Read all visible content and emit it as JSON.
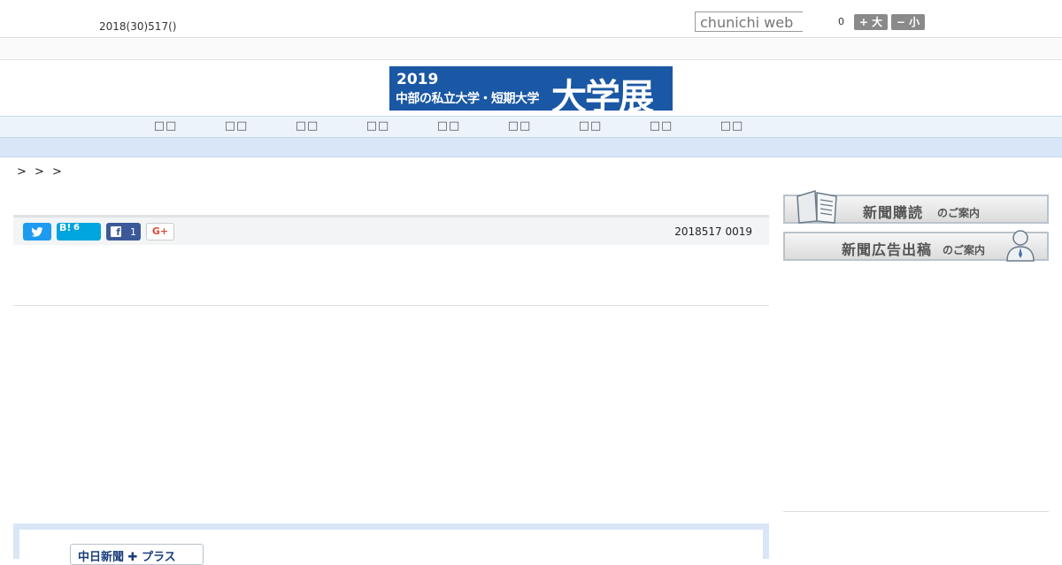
{
  "header": {
    "date": "2018(30)517()",
    "search_placeholder": "chunichi web",
    "count": "0",
    "font_plus": "+ 大",
    "font_minus": "− 小"
  },
  "banner": {
    "year": "2019",
    "subtitle": "中部の私立大学・短期大学",
    "big": "大学展"
  },
  "nav": {
    "items": [
      "□□",
      "□□",
      "□□",
      "□□",
      "□□",
      "□□",
      "□□",
      "□□",
      "□□"
    ]
  },
  "breadcrumb": "> > >",
  "share": {
    "hatena_label": "B!",
    "hatena_count": "6",
    "facebook_count": "1",
    "gplus_label": "G+",
    "posted": "2018517 0019"
  },
  "sidebar": {
    "subscribe_big": "新聞購読",
    "subscribe_small": "のご案内",
    "ad_big": "新聞広告出稿",
    "ad_small": "のご案内"
  },
  "promo": {
    "logo_text": "中日新聞 ✚ プラス"
  },
  "colors": {
    "banner_bg": "#1a57a4",
    "nav_bg": "#edf3fb",
    "twitter": "#1d9bf0",
    "hatena": "#00a4de",
    "facebook": "#3b5998"
  }
}
